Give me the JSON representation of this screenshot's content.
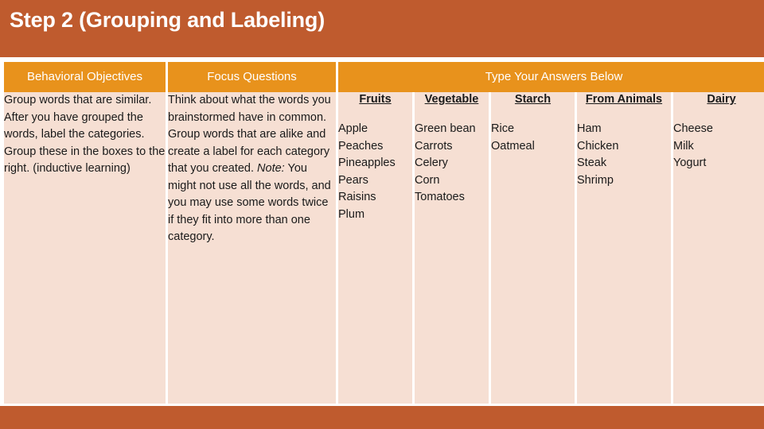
{
  "slide": {
    "title": "Step 2 (Grouping and Labeling)",
    "title_bar_color": "#BF5B2E",
    "header_cell_color": "#E8921C",
    "body_cell_color": "#F6DFD3",
    "header_text_color": "#FFFFFF"
  },
  "table": {
    "headers": {
      "objectives": "Behavioral Objectives",
      "focus": "Focus Questions",
      "answers": "Type Your Answers Below"
    },
    "objectives_text": "Group words that are similar. After you have grouped the words, label the categories. Group these in the boxes to the right.  (inductive learning)",
    "focus_text_part1": "Think about what the words you brainstormed have in common.  Group words that are alike and create a label for each category that you created. ",
    "focus_note_label": "Note:",
    "focus_text_part2": "  You might not use all the words, and you may use some words twice if they fit into more than one category.",
    "answer_columns": [
      {
        "label": "Fruits",
        "items": [
          "Apple",
          "Peaches",
          "Pineapples",
          "Pears",
          "Raisins",
          "Plum"
        ]
      },
      {
        "label": "Vegetable",
        "items": [
          "Green bean",
          "Carrots",
          "Celery",
          "Corn",
          "Tomatoes"
        ]
      },
      {
        "label": "Starch",
        "items": [
          "Rice",
          "Oatmeal"
        ]
      },
      {
        "label": "From Animals",
        "items": [
          "Ham",
          "Chicken",
          "Steak",
          "Shrimp"
        ]
      },
      {
        "label": "Dairy",
        "items": [
          "Cheese",
          "Milk",
          "Yogurt"
        ]
      }
    ]
  }
}
